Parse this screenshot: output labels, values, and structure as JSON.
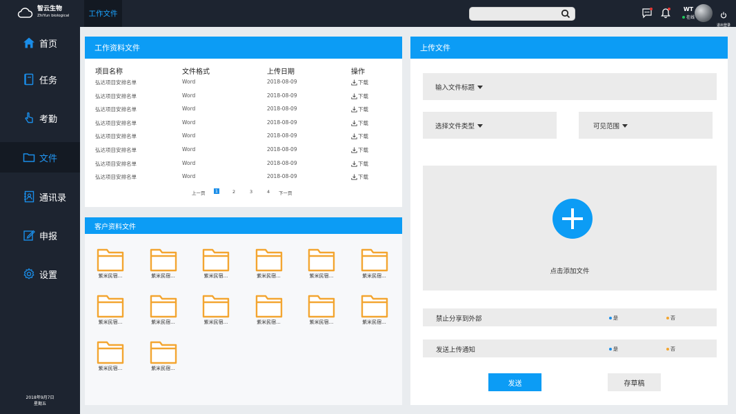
{
  "brand": {
    "name": "智云生物",
    "sub": "ZhiYun biological"
  },
  "topbar": {
    "tab_label": "工作文件",
    "search_placeholder": "",
    "user_name": "WT",
    "user_status": "在线",
    "logout_label": "退出登录"
  },
  "sidebar": {
    "items": [
      {
        "label": "首页",
        "icon": "home-icon"
      },
      {
        "label": "任务",
        "icon": "notebook-icon"
      },
      {
        "label": "考勤",
        "icon": "hand-pointer-icon"
      },
      {
        "label": "文件",
        "icon": "folder-icon",
        "active": true
      },
      {
        "label": "通讯录",
        "icon": "contacts-icon"
      },
      {
        "label": "申报",
        "icon": "edit-icon"
      },
      {
        "label": "设置",
        "icon": "gear-icon"
      }
    ],
    "date": "2018年9月7日",
    "weekday": "星期五"
  },
  "work_files": {
    "title": "工作资料文件",
    "columns": [
      "项目名称",
      "文件格式",
      "上传日期",
      "操作"
    ],
    "rows": [
      {
        "name": "弘达项目安排名单",
        "format": "Word",
        "date": "2018-08-09",
        "action": "下载"
      },
      {
        "name": "弘达项目安排名单",
        "format": "Word",
        "date": "2018-08-09",
        "action": "下载"
      },
      {
        "name": "弘达项目安排名单",
        "format": "Word",
        "date": "2018-08-09",
        "action": "下载"
      },
      {
        "name": "弘达项目安排名单",
        "format": "Word",
        "date": "2018-08-09",
        "action": "下载"
      },
      {
        "name": "弘达项目安排名单",
        "format": "Word",
        "date": "2018-08-09",
        "action": "下载"
      },
      {
        "name": "弘达项目安排名单",
        "format": "Word",
        "date": "2018-08-09",
        "action": "下载"
      },
      {
        "name": "弘达项目安排名单",
        "format": "Word",
        "date": "2018-08-09",
        "action": "下载"
      },
      {
        "name": "弘达项目安排名单",
        "format": "Word",
        "date": "2018-08-09",
        "action": "下载"
      }
    ],
    "pagination": {
      "prev": "上一页",
      "pages": [
        "1",
        "2",
        "3",
        "4"
      ],
      "current": "1",
      "next": "下一页"
    }
  },
  "client_files": {
    "title": "客户资料文件",
    "folders": [
      "紫米民宿...",
      "紫米民宿...",
      "紫米民宿...",
      "紫米民宿...",
      "紫米民宿...",
      "紫米民宿...",
      "紫米民宿...",
      "紫米民宿...",
      "紫米民宿...",
      "紫米民宿...",
      "紫米民宿...",
      "紫米民宿...",
      "紫米民宿...",
      "紫米民宿..."
    ]
  },
  "upload": {
    "title": "上传文件",
    "title_field": "输入文件标题",
    "type_field": "选择文件类型",
    "scope_field": "可见范围",
    "add_file": "点击添加文件",
    "share_label": "禁止分享到外部",
    "notify_label": "发送上传通知",
    "yes": "是",
    "no": "否",
    "send": "发送",
    "draft": "存草稿"
  },
  "colors": {
    "accent": "#0c9cf5",
    "sidebar": "#1d2430",
    "folder": "#f3a530",
    "radio_yes": "#1a8de8",
    "radio_no": "#f3a530"
  }
}
